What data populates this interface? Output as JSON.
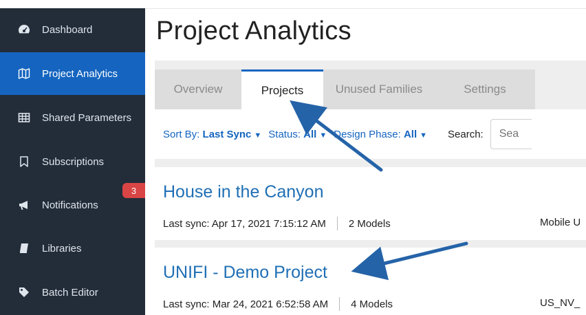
{
  "sidebar": {
    "items": [
      {
        "label": "Dashboard",
        "icon": "dashboard-icon"
      },
      {
        "label": "Project Analytics",
        "icon": "map-icon"
      },
      {
        "label": "Shared Parameters",
        "icon": "table-icon"
      },
      {
        "label": "Subscriptions",
        "icon": "bookmark-icon"
      },
      {
        "label": "Notifications",
        "icon": "megaphone-icon"
      },
      {
        "label": "Libraries",
        "icon": "book-icon"
      },
      {
        "label": "Batch Editor",
        "icon": "tag-icon"
      }
    ],
    "notifications_badge": "3",
    "active_index": 1
  },
  "header": {
    "title": "Project Analytics"
  },
  "tabs": [
    {
      "label": "Overview"
    },
    {
      "label": "Projects"
    },
    {
      "label": "Unused Families"
    },
    {
      "label": "Settings"
    }
  ],
  "active_tab": "Projects",
  "filters": {
    "sort_label": "Sort By:",
    "sort_value": "Last Sync",
    "status_label": "Status:",
    "status_value": "All",
    "phase_label": "Design Phase:",
    "phase_value": "All",
    "search_label": "Search:",
    "search_placeholder": "Sea"
  },
  "projects": [
    {
      "title": "House in the Canyon",
      "last_sync": "Last sync: Apr 17, 2021 7:15:12 AM",
      "models": "2 Models",
      "right_text": "Mobile U"
    },
    {
      "title": "UNIFI - Demo Project",
      "last_sync": "Last sync: Mar 24, 2021 6:52:58 AM",
      "models": "4 Models",
      "right_text": "US_NV_"
    }
  ],
  "colors": {
    "sidebar_bg": "#232d3a",
    "active_blue": "#1565c0",
    "link_blue": "#1f6fb5",
    "badge_red": "#d94545",
    "annotation_arrow": "#2563a8"
  }
}
